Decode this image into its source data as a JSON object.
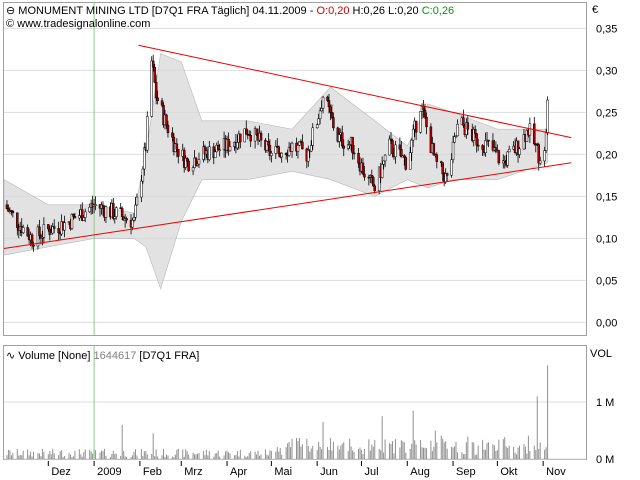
{
  "header": {
    "name": "MONUMENT MINING LTD",
    "symbol": "[D7Q1 FRA",
    "interval": "Täglich]",
    "date": "04.11.2009",
    "open": "O:0,20",
    "high": "H:0,26",
    "low": "L:0,20",
    "close": "C:0,26"
  },
  "source": "www.tradesignalonline.com",
  "currency": "€",
  "volume_header": {
    "label": "Volume [None]",
    "value": "1644617",
    "symbol": "[D7Q1 FRA]"
  },
  "volume_unit": "VOL",
  "colors": {
    "up": "#ffffff",
    "down": "#aa0000",
    "trendline": "#ee0000",
    "band": "#d8d8d8",
    "grid": "#dddddd",
    "vline": "#88cc88",
    "volume": "#909090"
  },
  "chart_data": [
    {
      "type": "candlestick",
      "ylim": [
        -0.015,
        0.36
      ],
      "yticks": [
        "0,35",
        "0,30",
        "0,25",
        "0,20",
        "0,15",
        "0,10",
        "0,05",
        "0,00"
      ],
      "ytick_values": [
        0.35,
        0.3,
        0.25,
        0.2,
        0.15,
        0.1,
        0.05,
        0.0
      ],
      "xlabels": [
        "Dez",
        "2009",
        "Feb",
        "Mrz",
        "Apr",
        "Mai",
        "Jun",
        "Jul",
        "Aug",
        "Sep",
        "Okt",
        "Nov"
      ],
      "x_start": "2008-11-01",
      "x_end": "2009-11-30",
      "xlabel_dates": [
        "2008-12-01",
        "2009-01-01",
        "2009-02-01",
        "2009-03-01",
        "2009-04-01",
        "2009-05-01",
        "2009-06-01",
        "2009-07-01",
        "2009-08-01",
        "2009-09-01",
        "2009-10-01",
        "2009-11-01"
      ],
      "anchors": [
        [
          "2008-11-01",
          0.14
        ],
        [
          "2008-11-10",
          0.12
        ],
        [
          "2008-11-20",
          0.1
        ],
        [
          "2008-12-01",
          0.11
        ],
        [
          "2008-12-15",
          0.12
        ],
        [
          "2009-01-01",
          0.14
        ],
        [
          "2009-01-15",
          0.13
        ],
        [
          "2009-01-28",
          0.12
        ],
        [
          "2009-02-05",
          0.21
        ],
        [
          "2009-02-09",
          0.31
        ],
        [
          "2009-02-12",
          0.27
        ],
        [
          "2009-02-18",
          0.24
        ],
        [
          "2009-02-25",
          0.21
        ],
        [
          "2009-03-05",
          0.19
        ],
        [
          "2009-03-15",
          0.2
        ],
        [
          "2009-04-01",
          0.21
        ],
        [
          "2009-04-15",
          0.23
        ],
        [
          "2009-05-01",
          0.2
        ],
        [
          "2009-05-15",
          0.21
        ],
        [
          "2009-05-25",
          0.2
        ],
        [
          "2009-06-01",
          0.24
        ],
        [
          "2009-06-05",
          0.27
        ],
        [
          "2009-06-15",
          0.22
        ],
        [
          "2009-06-25",
          0.21
        ],
        [
          "2009-07-05",
          0.17
        ],
        [
          "2009-07-10",
          0.16
        ],
        [
          "2009-07-20",
          0.21
        ],
        [
          "2009-08-01",
          0.19
        ],
        [
          "2009-08-10",
          0.26
        ],
        [
          "2009-08-20",
          0.19
        ],
        [
          "2009-08-28",
          0.17
        ],
        [
          "2009-09-05",
          0.24
        ],
        [
          "2009-09-15",
          0.22
        ],
        [
          "2009-09-25",
          0.21
        ],
        [
          "2009-10-05",
          0.19
        ],
        [
          "2009-10-15",
          0.21
        ],
        [
          "2009-10-22",
          0.23
        ],
        [
          "2009-10-29",
          0.2
        ],
        [
          "2009-11-02",
          0.2
        ],
        [
          "2009-11-04",
          0.26
        ]
      ],
      "band": [
        [
          "2008-11-01",
          0.17,
          0.08
        ],
        [
          "2008-12-01",
          0.14,
          0.09
        ],
        [
          "2009-01-01",
          0.14,
          0.1
        ],
        [
          "2009-01-28",
          0.13,
          0.1
        ],
        [
          "2009-02-05",
          0.2,
          0.09
        ],
        [
          "2009-02-15",
          0.32,
          0.04
        ],
        [
          "2009-03-01",
          0.31,
          0.12
        ],
        [
          "2009-03-15",
          0.24,
          0.17
        ],
        [
          "2009-04-15",
          0.24,
          0.17
        ],
        [
          "2009-05-15",
          0.23,
          0.18
        ],
        [
          "2009-06-10",
          0.28,
          0.17
        ],
        [
          "2009-07-10",
          0.24,
          0.15
        ],
        [
          "2009-08-01",
          0.21,
          0.17
        ],
        [
          "2009-08-15",
          0.26,
          0.16
        ],
        [
          "2009-09-01",
          0.25,
          0.17
        ],
        [
          "2009-10-01",
          0.23,
          0.17
        ],
        [
          "2009-11-04",
          0.23,
          0.19
        ]
      ],
      "trendlines": [
        {
          "from": [
            "2009-01-31",
            0.33
          ],
          "to": [
            "2009-11-20",
            0.22
          ]
        },
        {
          "from": [
            "2008-11-01",
            0.088
          ],
          "to": [
            "2009-11-20",
            0.19
          ]
        }
      ],
      "vline_date": "2009-01-01"
    },
    {
      "type": "bar",
      "ylim": [
        0,
        1650000
      ],
      "yticks": [
        "1 M",
        "0 M"
      ],
      "ytick_values": [
        1000000,
        0
      ],
      "xlabels": [
        "Dez",
        "2009",
        "Feb",
        "Mrz",
        "Apr",
        "Mai",
        "Jun",
        "Jul",
        "Aug",
        "Sep",
        "Okt",
        "Nov"
      ],
      "spikes": [
        [
          "2009-01-10",
          700000
        ],
        [
          "2009-01-20",
          600000
        ],
        [
          "2009-02-10",
          450000
        ],
        [
          "2009-06-05",
          650000
        ],
        [
          "2009-07-15",
          750000
        ],
        [
          "2009-08-05",
          850000
        ],
        [
          "2009-08-20",
          500000
        ],
        [
          "2009-09-05",
          1000000
        ],
        [
          "2009-10-28",
          1100000
        ],
        [
          "2009-11-04",
          1644617
        ]
      ]
    }
  ]
}
